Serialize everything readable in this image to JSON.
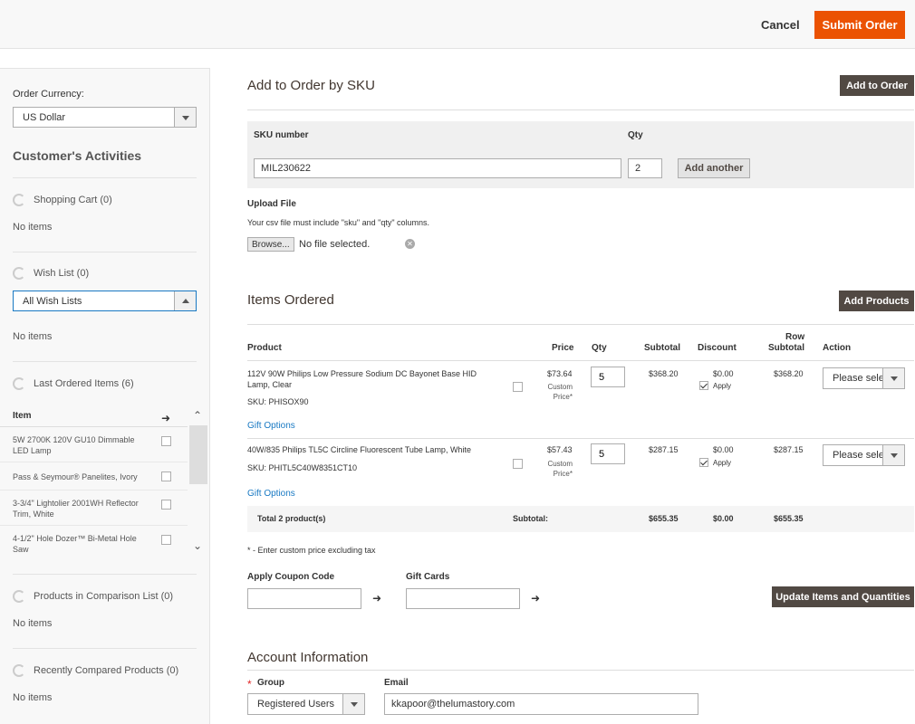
{
  "header": {
    "cancel_label": "Cancel",
    "submit_label": "Submit Order"
  },
  "sidebar": {
    "currency_label": "Order Currency:",
    "currency_value": "US Dollar",
    "title": "Customer's Activities",
    "shopping_cart": "Shopping Cart (0)",
    "shopping_cart_empty": "No items",
    "wish_list": "Wish List (0)",
    "wish_list_select": "All Wish Lists",
    "wish_list_empty": "No items",
    "last_ordered": "Last Ordered Items (6)",
    "last_ordered_col": "Item",
    "last_ordered_items": [
      "5W 2700K 120V GU10 Dimmable LED Lamp",
      "Pass & Seymour® Panelites, Ivory",
      "3-3/4\" Lightolier 2001WH Reflector Trim, White",
      "4-1/2\" Hole Dozer™ Bi-Metal Hole Saw"
    ],
    "comparison": "Products in Comparison List (0)",
    "comparison_empty": "No items",
    "recently_compared": "Recently Compared Products (0)",
    "recently_compared_empty": "No items"
  },
  "sku": {
    "title": "Add to Order by SKU",
    "add_to_order": "Add to Order",
    "sku_label": "SKU number",
    "qty_label": "Qty",
    "sku_value": "MIL230622",
    "qty_value": "2",
    "add_another": "Add another",
    "upload_label": "Upload File",
    "upload_hint": "Your csv file must include \"sku\" and \"qty\" columns.",
    "browse": "Browse...",
    "no_file": "No file selected."
  },
  "items": {
    "title": "Items Ordered",
    "add_products": "Add Products",
    "columns": {
      "product": "Product",
      "price": "Price",
      "qty": "Qty",
      "subtotal": "Subtotal",
      "discount": "Discount",
      "row_subtotal_1": "Row",
      "row_subtotal_2": "Subtotal",
      "action": "Action"
    },
    "rows": [
      {
        "name": "112V 90W Philips Low Pressure Sodium DC Bayonet Base HID Lamp, Clear",
        "sku": "SKU: PHISOX90",
        "price": "$73.64",
        "custom_price_1": "Custom",
        "custom_price_2": "Price*",
        "qty": "5",
        "subtotal": "$368.20",
        "discount": "$0.00",
        "apply": "Apply",
        "row_subtotal": "$368.20",
        "action": "Please sele",
        "gift": "Gift Options"
      },
      {
        "name": "40W/835 Philips TL5C Circline Fluorescent Tube Lamp, White",
        "sku": "SKU: PHITL5C40W8351CT10",
        "price": "$57.43",
        "custom_price_1": "Custom",
        "custom_price_2": "Price*",
        "qty": "5",
        "subtotal": "$287.15",
        "discount": "$0.00",
        "apply": "Apply",
        "row_subtotal": "$287.15",
        "action": "Please sele",
        "gift": "Gift Options"
      }
    ],
    "total_label": "Total 2 product(s)",
    "subtotal_label": "Subtotal:",
    "total_subtotal": "$655.35",
    "total_discount": "$0.00",
    "total_row_subtotal": "$655.35",
    "note": "* - Enter custom price excluding tax",
    "coupon_label": "Apply Coupon Code",
    "gift_cards_label": "Gift Cards",
    "update_button": "Update Items and Quantities"
  },
  "account": {
    "title": "Account Information",
    "group_label": "Group",
    "group_value": "Registered Users",
    "email_label": "Email",
    "email_value": "kkapoor@thelumastory.com"
  },
  "colors": {
    "accent": "#eb5202",
    "dark_button": "#514943",
    "link": "#1979c3"
  }
}
